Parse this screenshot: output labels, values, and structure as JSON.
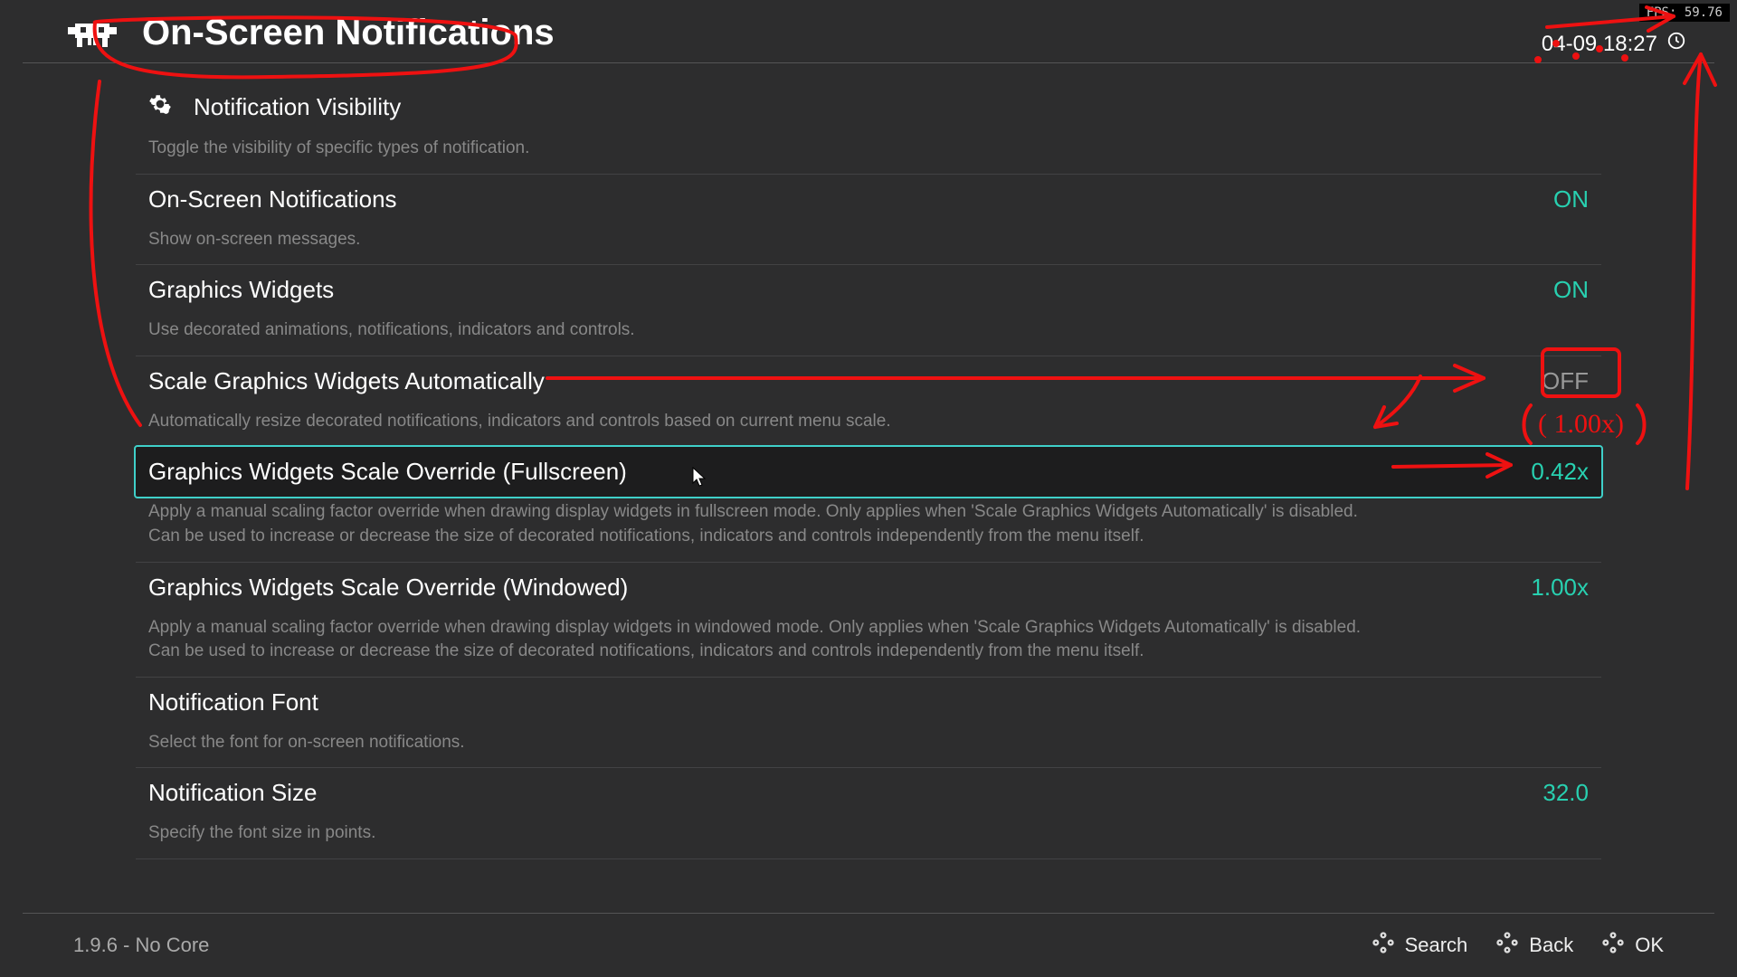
{
  "header": {
    "title": "On-Screen Notifications",
    "datetime": "04-09 18:27",
    "fps_label": "FPS: 59.76"
  },
  "items": [
    {
      "label": "Notification Visibility",
      "value": "",
      "desc": "Toggle the visibility of specific types of notification.",
      "has_icon": true
    },
    {
      "label": "On-Screen Notifications",
      "value": "ON",
      "desc": "Show on-screen messages."
    },
    {
      "label": "Graphics Widgets",
      "value": "ON",
      "desc": "Use decorated animations, notifications, indicators and controls."
    },
    {
      "label": "Scale Graphics Widgets Automatically",
      "value": "OFF",
      "value_off": true,
      "desc": "Automatically resize decorated notifications, indicators and controls based on current menu scale."
    },
    {
      "label": "Graphics Widgets Scale Override (Fullscreen)",
      "value": "0.42x",
      "selected": true,
      "desc": "Apply a manual scaling factor override when drawing display widgets in fullscreen mode. Only applies when 'Scale Graphics Widgets Automatically' is disabled. Can be used to increase or decrease the size of decorated notifications, indicators and controls independently from the menu itself."
    },
    {
      "label": "Graphics Widgets Scale Override (Windowed)",
      "value": "1.00x",
      "desc": "Apply a manual scaling factor override when drawing display widgets in windowed mode. Only applies when 'Scale Graphics Widgets Automatically' is disabled. Can be used to increase or decrease the size of decorated notifications, indicators and controls independently from the menu itself."
    },
    {
      "label": "Notification Font",
      "value": "",
      "desc": "Select the font for on-screen notifications."
    },
    {
      "label": "Notification Size",
      "value": "32.0",
      "desc": "Specify the font size in points."
    }
  ],
  "footer": {
    "version": "1.9.6 - No Core",
    "hints": [
      {
        "label": "Search"
      },
      {
        "label": "Back"
      },
      {
        "label": "OK"
      }
    ]
  },
  "annotations": {
    "aside_text": "( 1.00x)"
  }
}
